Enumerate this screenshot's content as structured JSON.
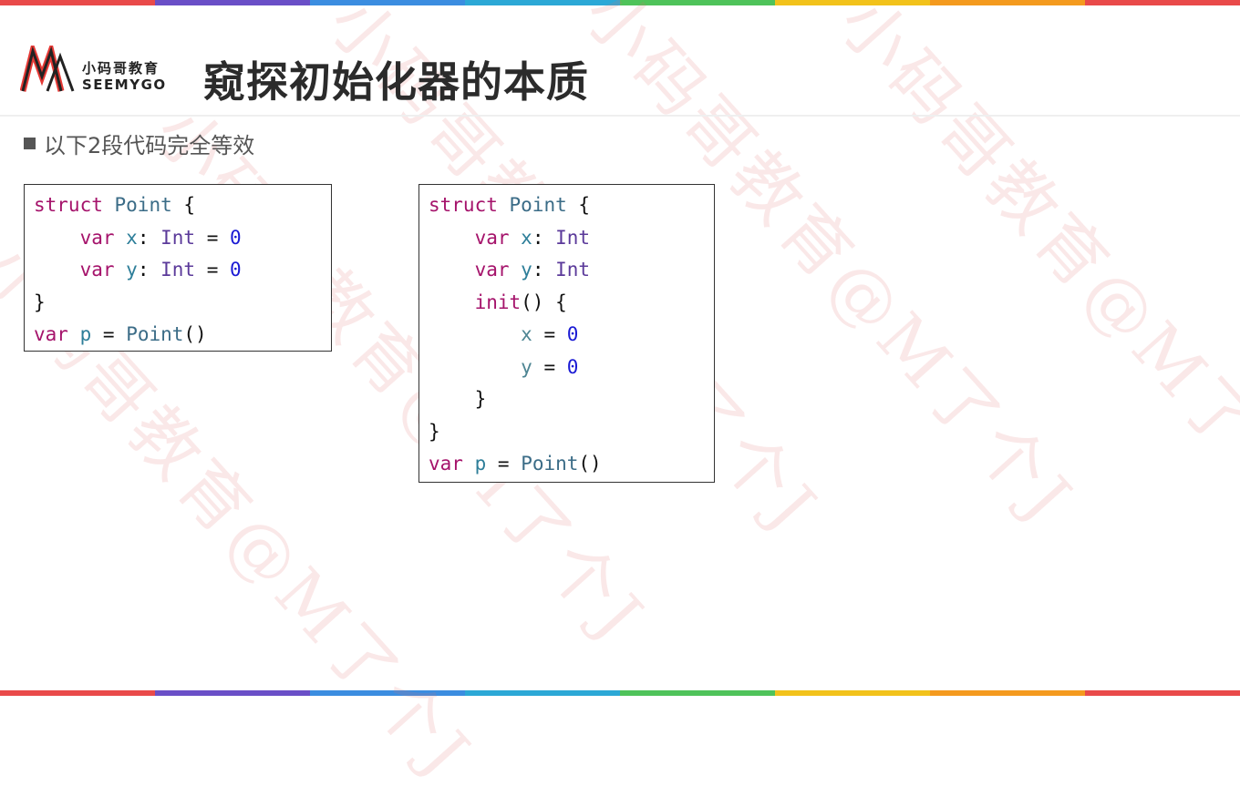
{
  "colors": {
    "stripe": [
      "#e94a4a",
      "#6a4fc7",
      "#3b8de0",
      "#2ca8d6",
      "#4fc35a",
      "#f2c21b",
      "#f49a1e",
      "#e94a4a"
    ],
    "keyword": "#a5136b",
    "type_name": "#3b6c87",
    "number": "#1a1ad4"
  },
  "logo": {
    "cn": "小码哥教育",
    "en": "SEEMYGO"
  },
  "title": "窥探初始化器的本质",
  "bullet": "以下2段代码完全等效",
  "watermark": "小码哥教育@M了个J",
  "code_left": [
    [
      {
        "t": "struct ",
        "c": "kw"
      },
      {
        "t": "Point",
        "c": "ty"
      },
      {
        "t": " {",
        "c": ""
      }
    ],
    [
      {
        "t": "    ",
        "c": ""
      },
      {
        "t": "var",
        "c": "kw"
      },
      {
        "t": " ",
        "c": ""
      },
      {
        "t": "x",
        "c": "var"
      },
      {
        "t": ": ",
        "c": ""
      },
      {
        "t": "Int",
        "c": "tp"
      },
      {
        "t": " = ",
        "c": ""
      },
      {
        "t": "0",
        "c": "num"
      }
    ],
    [
      {
        "t": "    ",
        "c": ""
      },
      {
        "t": "var",
        "c": "kw"
      },
      {
        "t": " ",
        "c": ""
      },
      {
        "t": "y",
        "c": "var"
      },
      {
        "t": ": ",
        "c": ""
      },
      {
        "t": "Int",
        "c": "tp"
      },
      {
        "t": " = ",
        "c": ""
      },
      {
        "t": "0",
        "c": "num"
      }
    ],
    [
      {
        "t": "}",
        "c": ""
      }
    ],
    [
      {
        "t": "var",
        "c": "kw"
      },
      {
        "t": " ",
        "c": ""
      },
      {
        "t": "p",
        "c": "var"
      },
      {
        "t": " = ",
        "c": ""
      },
      {
        "t": "Point",
        "c": "ty"
      },
      {
        "t": "()",
        "c": ""
      }
    ]
  ],
  "code_right": [
    [
      {
        "t": "struct ",
        "c": "kw"
      },
      {
        "t": "Point",
        "c": "ty"
      },
      {
        "t": " {",
        "c": ""
      }
    ],
    [
      {
        "t": "    ",
        "c": ""
      },
      {
        "t": "var",
        "c": "kw"
      },
      {
        "t": " ",
        "c": ""
      },
      {
        "t": "x",
        "c": "var"
      },
      {
        "t": ": ",
        "c": ""
      },
      {
        "t": "Int",
        "c": "tp"
      }
    ],
    [
      {
        "t": "    ",
        "c": ""
      },
      {
        "t": "var",
        "c": "kw"
      },
      {
        "t": " ",
        "c": ""
      },
      {
        "t": "y",
        "c": "var"
      },
      {
        "t": ": ",
        "c": ""
      },
      {
        "t": "Int",
        "c": "tp"
      }
    ],
    [
      {
        "t": "    ",
        "c": ""
      },
      {
        "t": "init",
        "c": "kw"
      },
      {
        "t": "() {",
        "c": ""
      }
    ],
    [
      {
        "t": "        ",
        "c": ""
      },
      {
        "t": "x",
        "c": "prop"
      },
      {
        "t": " = ",
        "c": ""
      },
      {
        "t": "0",
        "c": "num"
      }
    ],
    [
      {
        "t": "        ",
        "c": ""
      },
      {
        "t": "y",
        "c": "prop"
      },
      {
        "t": " = ",
        "c": ""
      },
      {
        "t": "0",
        "c": "num"
      }
    ],
    [
      {
        "t": "    }",
        "c": ""
      }
    ],
    [
      {
        "t": "}",
        "c": ""
      }
    ],
    [
      {
        "t": "var",
        "c": "kw"
      },
      {
        "t": " ",
        "c": ""
      },
      {
        "t": "p",
        "c": "var"
      },
      {
        "t": " = ",
        "c": ""
      },
      {
        "t": "Point",
        "c": "ty"
      },
      {
        "t": "()",
        "c": ""
      }
    ]
  ]
}
